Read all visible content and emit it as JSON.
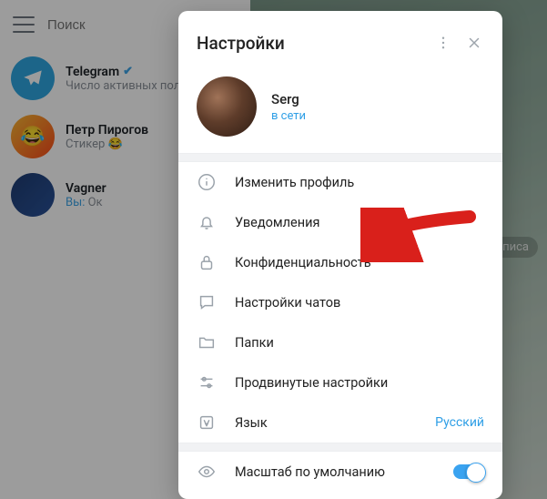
{
  "search": {
    "placeholder": "Поиск"
  },
  "chats": [
    {
      "name": "Telegram",
      "sub": "Число активных польз",
      "verified": true
    },
    {
      "name": "Петр Пирогов",
      "sub": "Стикер 😂"
    },
    {
      "name": "Vagner",
      "you": "Вы:",
      "sub": " Ок"
    }
  ],
  "pane_hint": "о написа",
  "settings": {
    "title": "Настройки",
    "profile": {
      "name": "Serg",
      "status": "в сети"
    },
    "items": {
      "edit": "Изменить профиль",
      "notif": "Уведомления",
      "privacy": "Конфиденциальность",
      "chat": "Настройки чатов",
      "folders": "Папки",
      "advanced": "Продвинутые настройки",
      "lang": "Язык",
      "lang_value": "Русский",
      "scale": "Масштаб по умолчанию"
    }
  }
}
